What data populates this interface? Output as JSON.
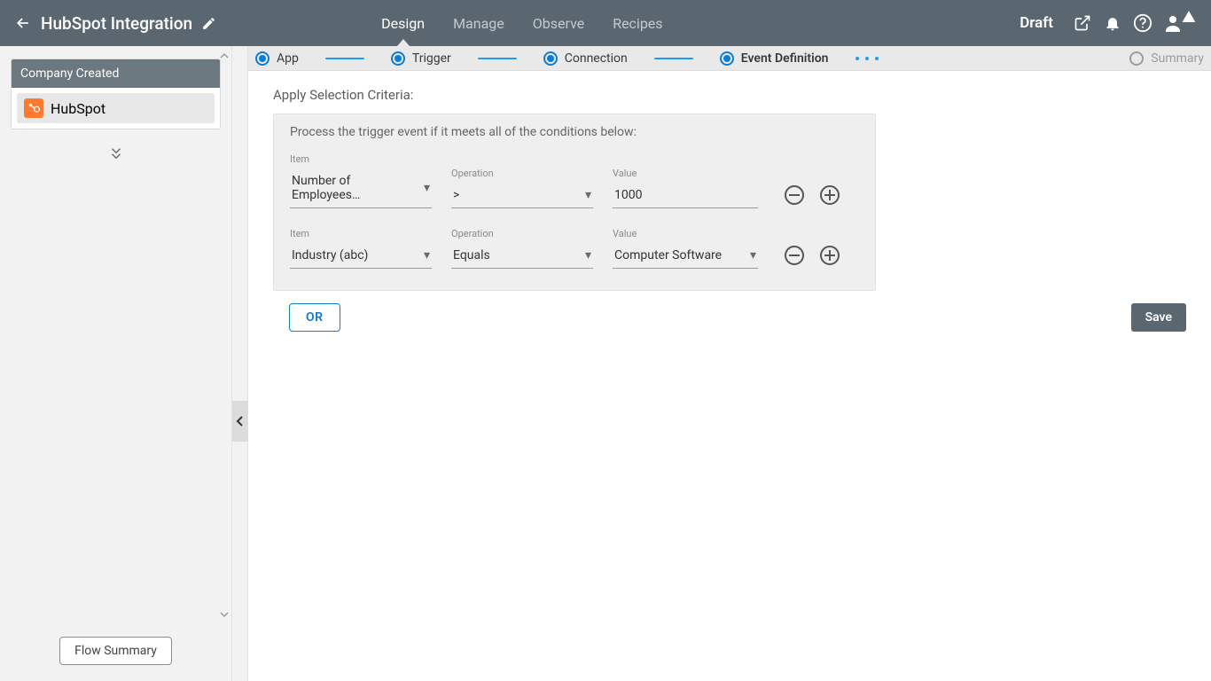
{
  "header": {
    "title": "HubSpot Integration",
    "tabs": [
      "Design",
      "Manage",
      "Observe",
      "Recipes"
    ],
    "active_tab": 0,
    "status": "Draft"
  },
  "sidebar": {
    "panel_title": "Company Created",
    "app_item": "HubSpot",
    "flow_summary_label": "Flow Summary"
  },
  "stepper": {
    "steps": [
      "App",
      "Trigger",
      "Connection",
      "Event Definition",
      "Summary"
    ],
    "active": 3
  },
  "content": {
    "section_label": "Apply Selection Criteria:",
    "intro": "Process the trigger event if it meets all of the conditions below:",
    "labels": {
      "item": "Item",
      "operation": "Operation",
      "value": "Value"
    },
    "conditions": [
      {
        "item": "Number of Employees…",
        "operation": ">",
        "value": "1000",
        "value_is_dropdown": false
      },
      {
        "item": "Industry  (abc)",
        "operation": "Equals",
        "value": "Computer Software",
        "value_is_dropdown": true
      }
    ],
    "or_label": "OR",
    "save_label": "Save"
  }
}
